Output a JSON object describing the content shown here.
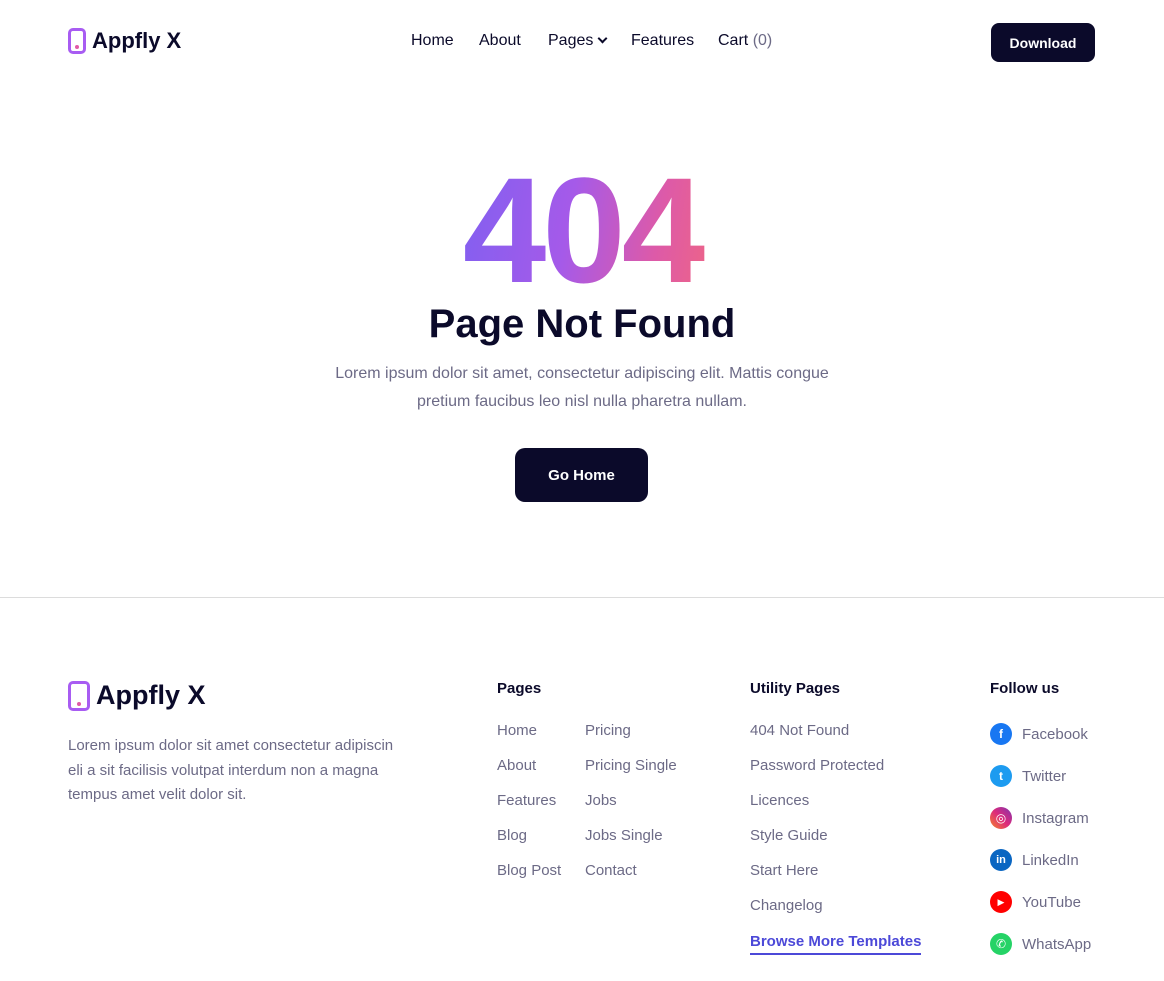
{
  "brand": {
    "name": "Appfly X"
  },
  "nav": {
    "items": [
      {
        "label": "Home"
      },
      {
        "label": "About"
      },
      {
        "label": "Pages"
      },
      {
        "label": "Features"
      },
      {
        "label": "Cart",
        "count": "(0)"
      }
    ],
    "download_label": "Download"
  },
  "hero": {
    "code": "404",
    "title": "Page Not Found",
    "description": "Lorem ipsum dolor sit amet, consectetur adipiscing elit. Mattis congue pretium faucibus leo nisl nulla pharetra nullam.",
    "button_label": "Go Home"
  },
  "footer": {
    "description": "Lorem ipsum dolor sit amet consectetur adipiscin eli a sit facilisis volutpat interdum non a magna tempus amet velit dolor sit.",
    "pages": {
      "title": "Pages",
      "col1": [
        "Home",
        "About",
        "Features",
        "Blog",
        "Blog Post"
      ],
      "col2": [
        "Pricing",
        "Pricing Single",
        "Jobs",
        "Jobs Single",
        "Contact"
      ]
    },
    "utility": {
      "title": "Utility Pages",
      "links": [
        "404 Not Found",
        "Password Protected",
        "Licences",
        "Style Guide",
        "Start Here",
        "Changelog"
      ],
      "browse": "Browse More Templates"
    },
    "follow": {
      "title": "Follow us",
      "items": [
        {
          "label": "Facebook",
          "icon": "facebook-icon",
          "color": "#1877f2",
          "glyph": "f"
        },
        {
          "label": "Twitter",
          "icon": "twitter-icon",
          "color": "#1d9bf0",
          "glyph": "t"
        },
        {
          "label": "Instagram",
          "icon": "instagram-icon",
          "color": "#e1306c",
          "glyph": "◎"
        },
        {
          "label": "LinkedIn",
          "icon": "linkedin-icon",
          "color": "#0a66c2",
          "glyph": "in"
        },
        {
          "label": "YouTube",
          "icon": "youtube-icon",
          "color": "#ff0000",
          "glyph": "▶"
        },
        {
          "label": "WhatsApp",
          "icon": "whatsapp-icon",
          "color": "#25d366",
          "glyph": "✆"
        }
      ]
    }
  },
  "colors": {
    "primary_dark": "#0b0a2a",
    "accent": "#4c49d8",
    "gradient_start": "#7a61f2",
    "gradient_end": "#f2677e"
  }
}
